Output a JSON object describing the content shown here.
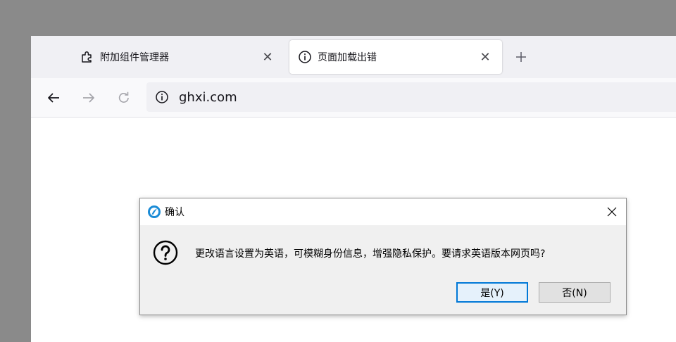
{
  "browser": {
    "tabs": [
      {
        "label": "附加组件管理器",
        "icon": "puzzle-icon",
        "active": false
      },
      {
        "label": "页面加载出错",
        "icon": "info-icon",
        "active": true
      }
    ],
    "tab_close_glyph": "✕",
    "url": "ghxi.com"
  },
  "dialog": {
    "title": "确认",
    "message": "更改语言设置为英语，可模糊身份信息，增强隐私保护。要请求英语版本网页吗?",
    "yes_label": "是(Y)",
    "no_label": "否(N)"
  },
  "colors": {
    "backdrop": "#8a8a8a",
    "tabbar": "#f0f0f4",
    "dialog_bg": "#f0f0f0",
    "default_button_border": "#0078d7"
  }
}
